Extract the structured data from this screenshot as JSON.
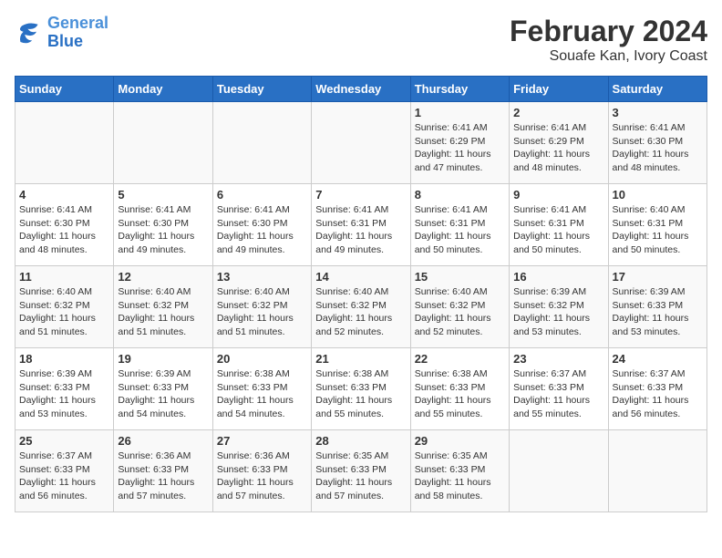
{
  "logo": {
    "text_general": "General",
    "text_blue": "Blue"
  },
  "title": "February 2024",
  "subtitle": "Souafe Kan, Ivory Coast",
  "days_of_week": [
    "Sunday",
    "Monday",
    "Tuesday",
    "Wednesday",
    "Thursday",
    "Friday",
    "Saturday"
  ],
  "weeks": [
    [
      {
        "num": "",
        "info": ""
      },
      {
        "num": "",
        "info": ""
      },
      {
        "num": "",
        "info": ""
      },
      {
        "num": "",
        "info": ""
      },
      {
        "num": "1",
        "info": "Sunrise: 6:41 AM\nSunset: 6:29 PM\nDaylight: 11 hours\nand 47 minutes."
      },
      {
        "num": "2",
        "info": "Sunrise: 6:41 AM\nSunset: 6:29 PM\nDaylight: 11 hours\nand 48 minutes."
      },
      {
        "num": "3",
        "info": "Sunrise: 6:41 AM\nSunset: 6:30 PM\nDaylight: 11 hours\nand 48 minutes."
      }
    ],
    [
      {
        "num": "4",
        "info": "Sunrise: 6:41 AM\nSunset: 6:30 PM\nDaylight: 11 hours\nand 48 minutes."
      },
      {
        "num": "5",
        "info": "Sunrise: 6:41 AM\nSunset: 6:30 PM\nDaylight: 11 hours\nand 49 minutes."
      },
      {
        "num": "6",
        "info": "Sunrise: 6:41 AM\nSunset: 6:30 PM\nDaylight: 11 hours\nand 49 minutes."
      },
      {
        "num": "7",
        "info": "Sunrise: 6:41 AM\nSunset: 6:31 PM\nDaylight: 11 hours\nand 49 minutes."
      },
      {
        "num": "8",
        "info": "Sunrise: 6:41 AM\nSunset: 6:31 PM\nDaylight: 11 hours\nand 50 minutes."
      },
      {
        "num": "9",
        "info": "Sunrise: 6:41 AM\nSunset: 6:31 PM\nDaylight: 11 hours\nand 50 minutes."
      },
      {
        "num": "10",
        "info": "Sunrise: 6:40 AM\nSunset: 6:31 PM\nDaylight: 11 hours\nand 50 minutes."
      }
    ],
    [
      {
        "num": "11",
        "info": "Sunrise: 6:40 AM\nSunset: 6:32 PM\nDaylight: 11 hours\nand 51 minutes."
      },
      {
        "num": "12",
        "info": "Sunrise: 6:40 AM\nSunset: 6:32 PM\nDaylight: 11 hours\nand 51 minutes."
      },
      {
        "num": "13",
        "info": "Sunrise: 6:40 AM\nSunset: 6:32 PM\nDaylight: 11 hours\nand 51 minutes."
      },
      {
        "num": "14",
        "info": "Sunrise: 6:40 AM\nSunset: 6:32 PM\nDaylight: 11 hours\nand 52 minutes."
      },
      {
        "num": "15",
        "info": "Sunrise: 6:40 AM\nSunset: 6:32 PM\nDaylight: 11 hours\nand 52 minutes."
      },
      {
        "num": "16",
        "info": "Sunrise: 6:39 AM\nSunset: 6:32 PM\nDaylight: 11 hours\nand 53 minutes."
      },
      {
        "num": "17",
        "info": "Sunrise: 6:39 AM\nSunset: 6:33 PM\nDaylight: 11 hours\nand 53 minutes."
      }
    ],
    [
      {
        "num": "18",
        "info": "Sunrise: 6:39 AM\nSunset: 6:33 PM\nDaylight: 11 hours\nand 53 minutes."
      },
      {
        "num": "19",
        "info": "Sunrise: 6:39 AM\nSunset: 6:33 PM\nDaylight: 11 hours\nand 54 minutes."
      },
      {
        "num": "20",
        "info": "Sunrise: 6:38 AM\nSunset: 6:33 PM\nDaylight: 11 hours\nand 54 minutes."
      },
      {
        "num": "21",
        "info": "Sunrise: 6:38 AM\nSunset: 6:33 PM\nDaylight: 11 hours\nand 55 minutes."
      },
      {
        "num": "22",
        "info": "Sunrise: 6:38 AM\nSunset: 6:33 PM\nDaylight: 11 hours\nand 55 minutes."
      },
      {
        "num": "23",
        "info": "Sunrise: 6:37 AM\nSunset: 6:33 PM\nDaylight: 11 hours\nand 55 minutes."
      },
      {
        "num": "24",
        "info": "Sunrise: 6:37 AM\nSunset: 6:33 PM\nDaylight: 11 hours\nand 56 minutes."
      }
    ],
    [
      {
        "num": "25",
        "info": "Sunrise: 6:37 AM\nSunset: 6:33 PM\nDaylight: 11 hours\nand 56 minutes."
      },
      {
        "num": "26",
        "info": "Sunrise: 6:36 AM\nSunset: 6:33 PM\nDaylight: 11 hours\nand 57 minutes."
      },
      {
        "num": "27",
        "info": "Sunrise: 6:36 AM\nSunset: 6:33 PM\nDaylight: 11 hours\nand 57 minutes."
      },
      {
        "num": "28",
        "info": "Sunrise: 6:35 AM\nSunset: 6:33 PM\nDaylight: 11 hours\nand 57 minutes."
      },
      {
        "num": "29",
        "info": "Sunrise: 6:35 AM\nSunset: 6:33 PM\nDaylight: 11 hours\nand 58 minutes."
      },
      {
        "num": "",
        "info": ""
      },
      {
        "num": "",
        "info": ""
      }
    ]
  ]
}
